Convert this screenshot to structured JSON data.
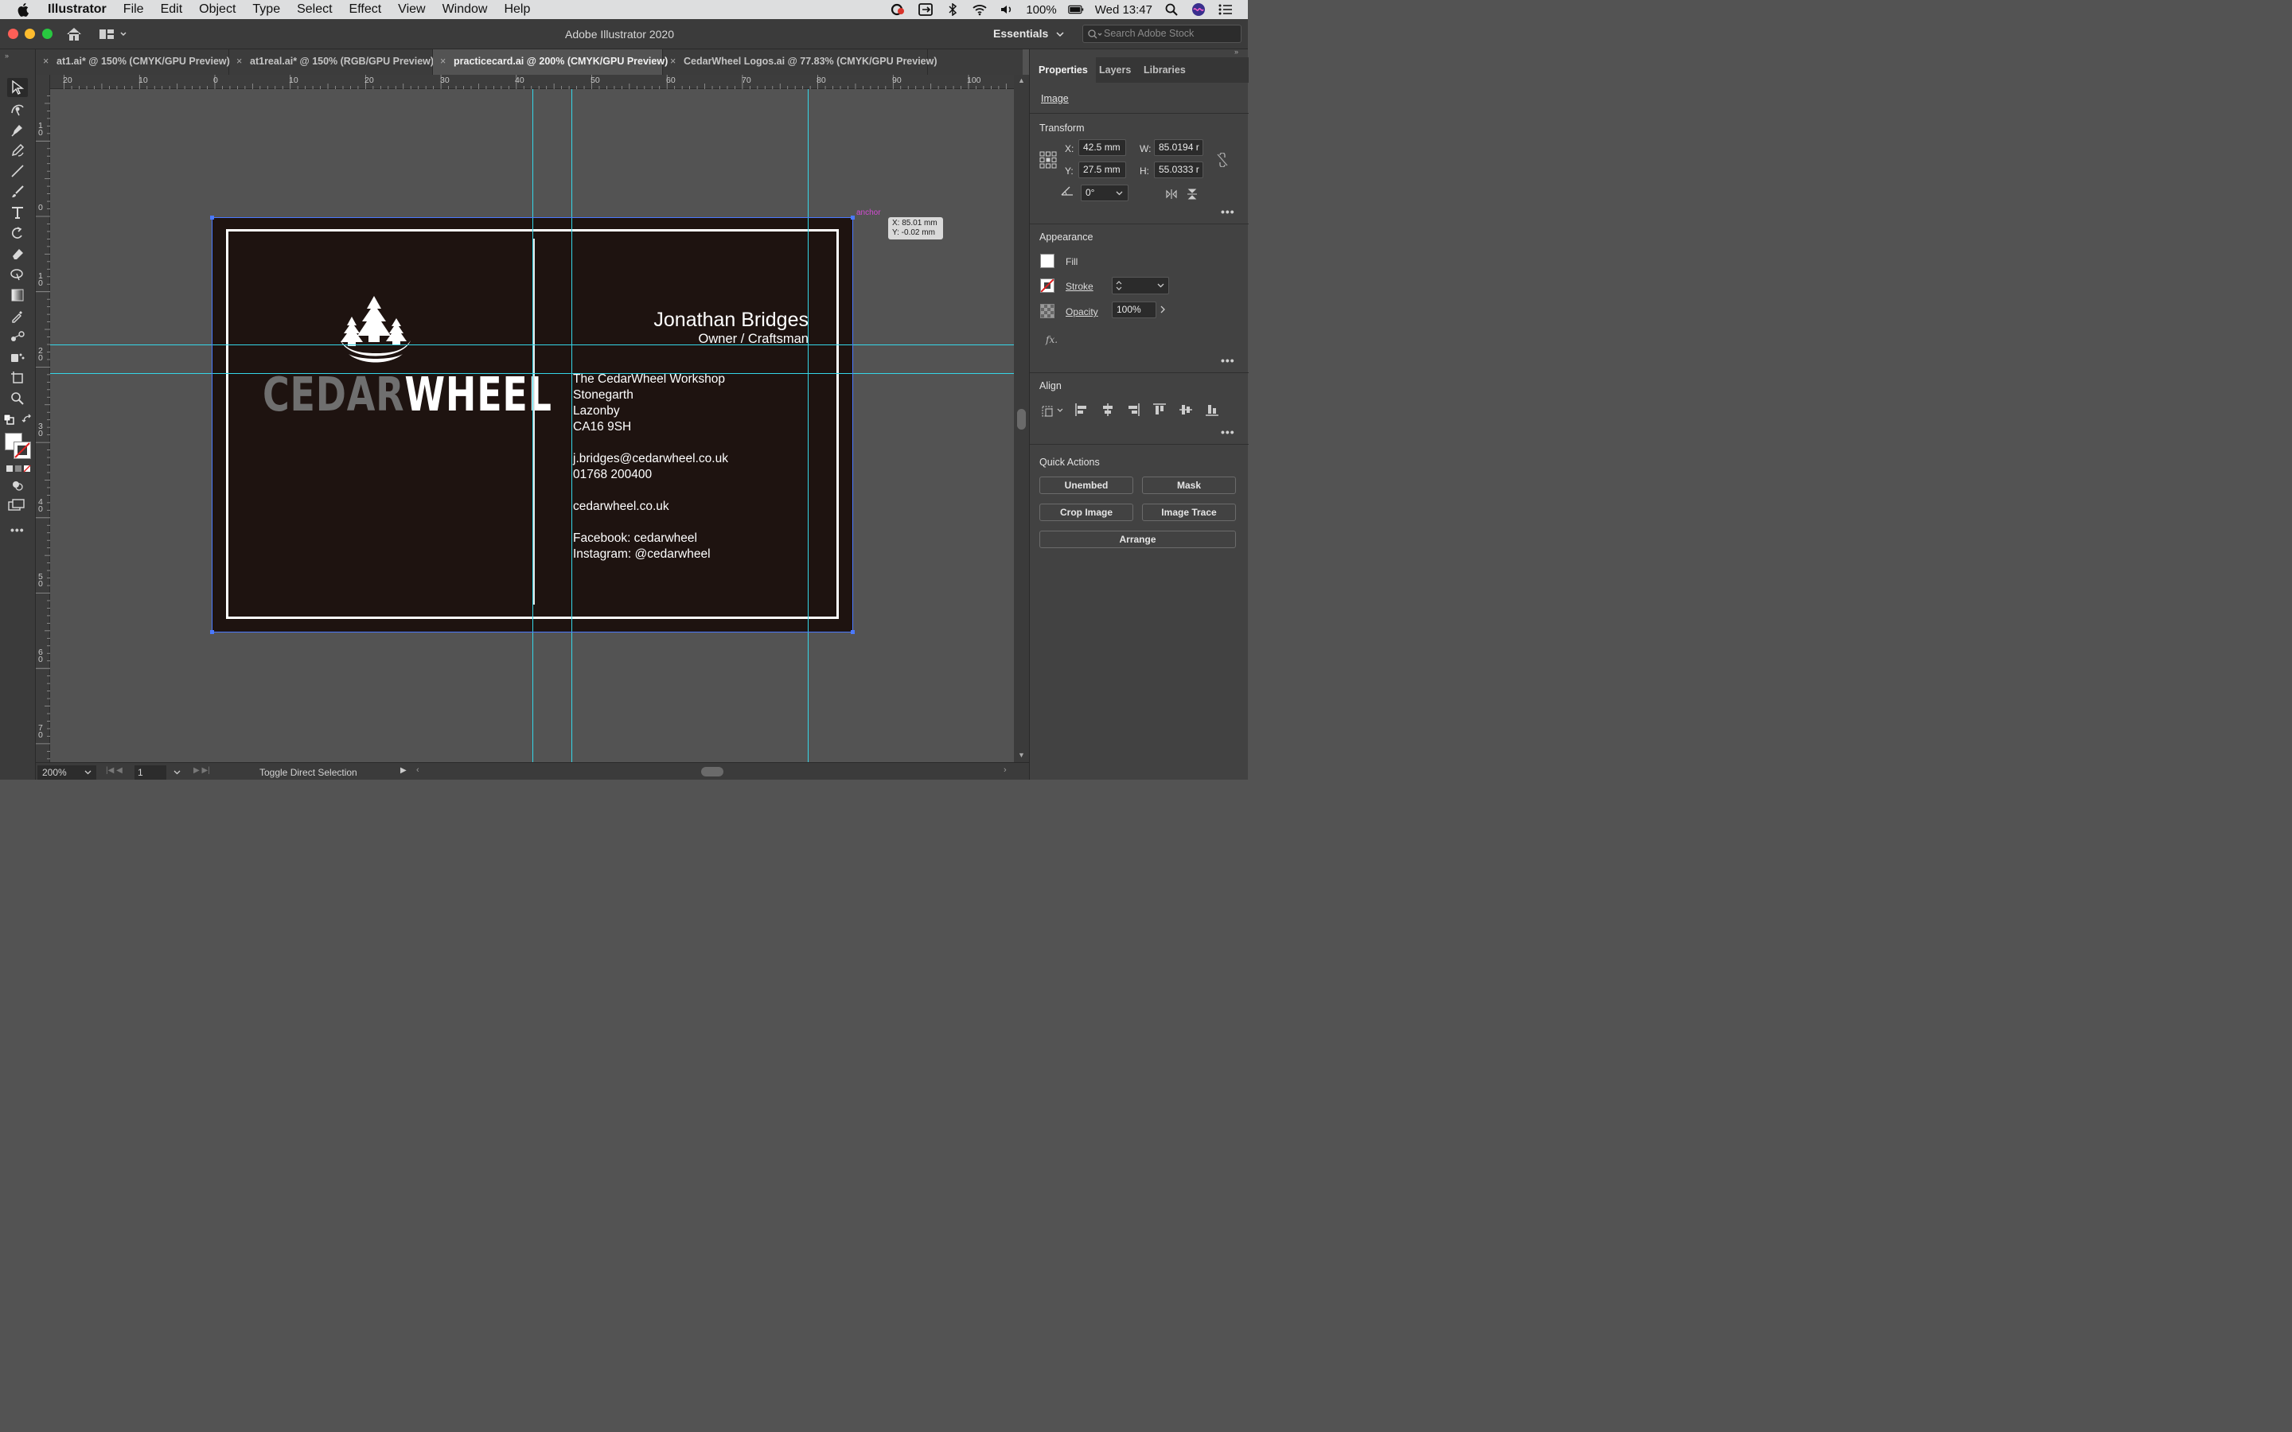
{
  "menubar": {
    "app_name": "Illustrator",
    "items": [
      "File",
      "Edit",
      "Object",
      "Type",
      "Select",
      "Effect",
      "View",
      "Window",
      "Help"
    ],
    "battery": "100%",
    "clock": "Wed 13:47"
  },
  "window": {
    "title": "Adobe Illustrator 2020",
    "workspace": "Essentials",
    "search_placeholder": "Search Adobe Stock"
  },
  "tabs": [
    {
      "label": "at1.ai* @ 150% (CMYK/GPU Preview)"
    },
    {
      "label": "at1real.ai* @ 150% (RGB/GPU Preview)"
    },
    {
      "label": "practicecard.ai @ 200% (CMYK/GPU Preview)",
      "active": true
    },
    {
      "label": "CedarWheel Logos.ai @ 77.83% (CMYK/GPU Preview)"
    }
  ],
  "ruler": {
    "h_labels": [
      "20",
      "10",
      "0",
      "10",
      "20",
      "30",
      "40",
      "50",
      "60",
      "70",
      "80",
      "90",
      "100"
    ],
    "v_labels": [
      "1\n0",
      "0",
      "1\n0",
      "2\n0",
      "3\n0",
      "4\n0",
      "5\n0",
      "6\n0",
      "7\n0"
    ]
  },
  "card": {
    "logo_part1": "CEDAR",
    "logo_part2": "WHEEL",
    "name": "Jonathan Bridges",
    "role": "Owner / Craftsman",
    "lines": [
      "The CedarWheel Workshop",
      "Stonegarth",
      "Lazonby",
      "CA16 9SH",
      "j.bridges@cedarwheel.co.uk",
      "01768 200400",
      "cedarwheel.co.uk",
      "Facebook: cedarwheel",
      "Instagram: @cedarwheel"
    ]
  },
  "canvas_overlay": {
    "anchor_label": "anchor",
    "coord_x": "X: 85.01 mm",
    "coord_y": "Y: -0.02 mm"
  },
  "status": {
    "zoom": "200%",
    "page": "1",
    "text": "Toggle Direct Selection"
  },
  "panel": {
    "tabs": [
      "Properties",
      "Layers",
      "Libraries"
    ],
    "object_type": "Image",
    "transform": {
      "title": "Transform",
      "x_label": "X:",
      "x": "42.5 mm",
      "y_label": "Y:",
      "y": "27.5 mm",
      "w_label": "W:",
      "w": "85.0194 r",
      "h_label": "H:",
      "h": "55.0333 r",
      "angle": "0°"
    },
    "appearance": {
      "title": "Appearance",
      "fill": "Fill",
      "stroke": "Stroke",
      "opacity_label": "Opacity",
      "opacity": "100%",
      "fx": "fx."
    },
    "align_title": "Align",
    "quick_actions": {
      "title": "Quick Actions",
      "unembed": "Unembed",
      "mask": "Mask",
      "crop": "Crop Image",
      "trace": "Image Trace",
      "arrange": "Arrange"
    }
  },
  "colors": {
    "guide": "#35d6e8",
    "selection": "#4a79ff",
    "card_bg": "#1e1310"
  }
}
